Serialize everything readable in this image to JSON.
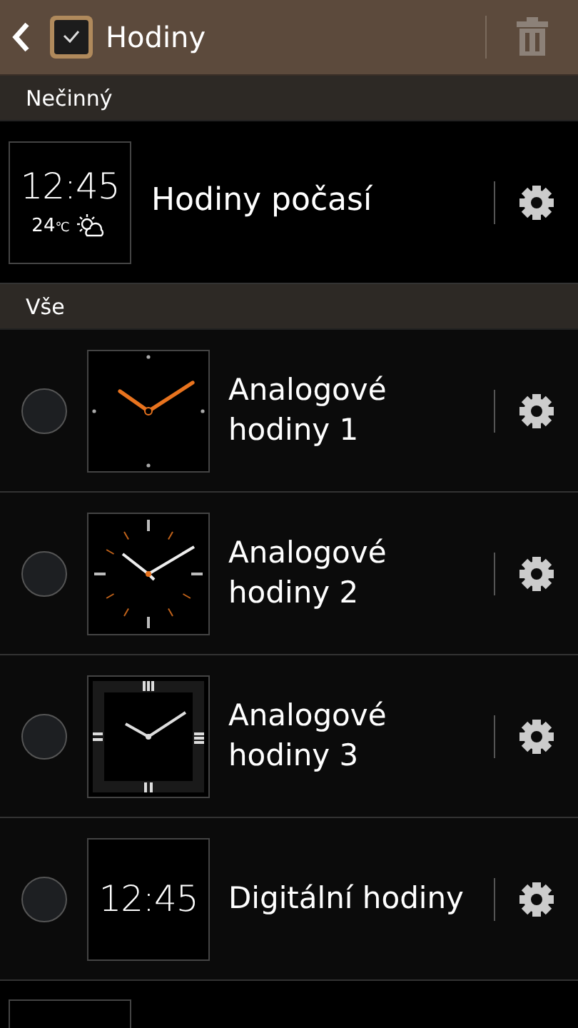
{
  "header": {
    "title": "Hodiny",
    "delete_button": {
      "disabled": true
    }
  },
  "sections": [
    {
      "title": "Nečinný",
      "items": [
        {
          "kind": "weather",
          "time": "12:45",
          "temperature": "24",
          "unit": "℃",
          "title": "Hodiny počasí",
          "selectable": false
        }
      ]
    },
    {
      "title": "Vše",
      "items": [
        {
          "kind": "analog1",
          "title": "Analogové hodiny 1",
          "selectable": true,
          "selected": false
        },
        {
          "kind": "analog2",
          "title": "Analogové hodiny 2",
          "selectable": true,
          "selected": false
        },
        {
          "kind": "analog3",
          "title": "Analogové hodiny 3",
          "selectable": true,
          "selected": false
        },
        {
          "kind": "digital",
          "time": "12:45",
          "title": "Digitální hodiny",
          "selectable": true,
          "selected": false
        },
        {
          "kind": "cut"
        }
      ]
    }
  ]
}
